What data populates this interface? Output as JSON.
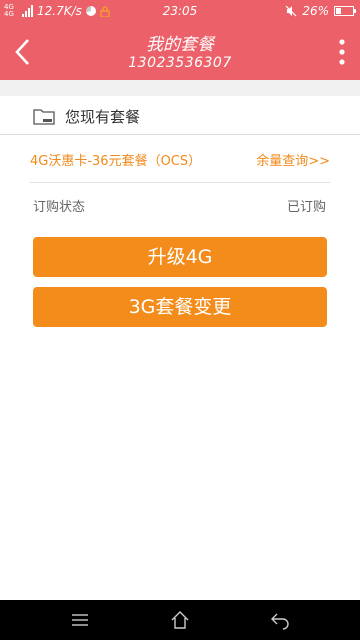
{
  "status_bar": {
    "network_type": "4G 4G",
    "speed": "12.7K/s",
    "time": "23:05",
    "battery": "26%"
  },
  "header": {
    "title": "我的套餐",
    "phone": "13023536307"
  },
  "section": {
    "title": "您现有套餐",
    "icon": "folder-icon"
  },
  "plan": {
    "name": "4G沃惠卡-36元套餐（OCS）",
    "balance_link": "余量查询>>"
  },
  "order": {
    "label": "订购状态",
    "value": "已订购"
  },
  "buttons": {
    "upgrade": "升级4G",
    "change": "3G套餐变更"
  },
  "colors": {
    "header_bg": "#ec6169",
    "accent": "#f38c1a",
    "link_text": "#f08a1b"
  }
}
